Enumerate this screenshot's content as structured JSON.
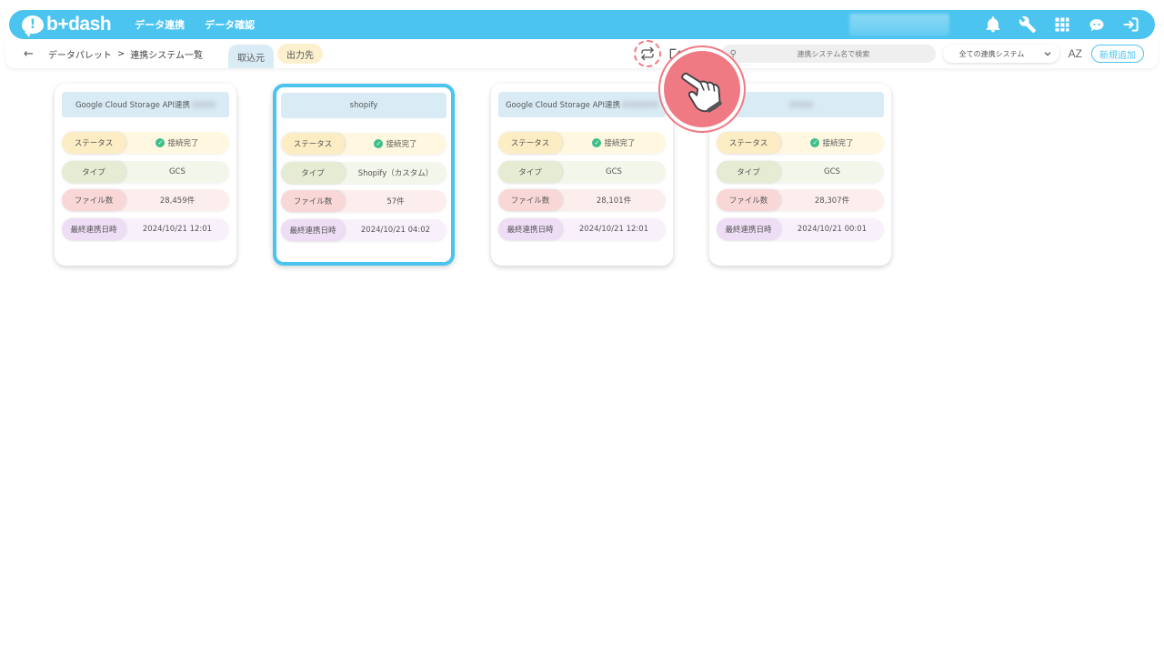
{
  "brand": {
    "logo_text": "b+dash",
    "bubble_mark": "!"
  },
  "nav": {
    "links": [
      "データ連携",
      "データ確認"
    ]
  },
  "icons": {
    "bell": "bell-icon",
    "wrench": "wrench-icon",
    "apps": "apps-grid-icon",
    "chat": "chat-bot-icon",
    "logout": "logout-icon"
  },
  "toolbar": {
    "back": "←",
    "breadcrumb": [
      "データパレット",
      ">",
      "連携システム一覧"
    ],
    "tabs": [
      "取込元",
      "出力先"
    ],
    "search_placeholder": "連携システム名で検索",
    "filter_value": "全ての連携システム",
    "sort_label": "AZ",
    "new_button": "新規追加"
  },
  "labels": {
    "status": "ステータス",
    "type": "タイプ",
    "files": "ファイル数",
    "date": "最終連携日時"
  },
  "cards": [
    {
      "title": "Google Cloud Storage API連携",
      "status": "接続完了",
      "type": "GCS",
      "files": "28,459件",
      "date": "2024/10/21 12:01"
    },
    {
      "title": "shopify",
      "status": "接続完了",
      "type": "Shopify（カスタム）",
      "files": "57件",
      "date": "2024/10/21 04:02"
    },
    {
      "title": "Google Cloud Storage API連携",
      "status": "接続完了",
      "type": "GCS",
      "files": "28,101件",
      "date": "2024/10/21 12:01"
    },
    {
      "title": "",
      "status": "接続完了",
      "type": "GCS",
      "files": "28,307件",
      "date": "2024/10/21 00:01"
    }
  ],
  "colors": {
    "accent": "#4cc4f0",
    "highlight": "#f07a84",
    "success": "#3dbf8a"
  }
}
